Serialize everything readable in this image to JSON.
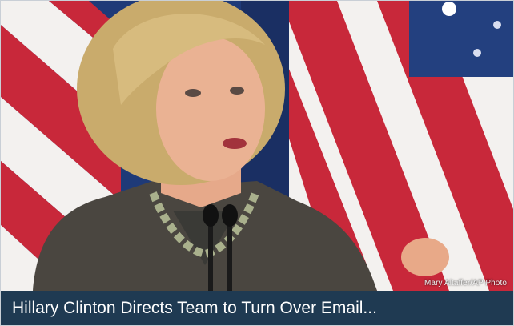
{
  "headline": "Hillary Clinton Directs Team to Turn Over Email...",
  "photo_credit": "Mary Altaffer/AP Photo",
  "colors": {
    "caption_bar": "#1f3a52",
    "flag_red": "#c8283a",
    "flag_white": "#f3f1ef",
    "flag_blue": "#1e3a78",
    "jacket": "#4a4640",
    "hair": "#c9ab6c"
  }
}
